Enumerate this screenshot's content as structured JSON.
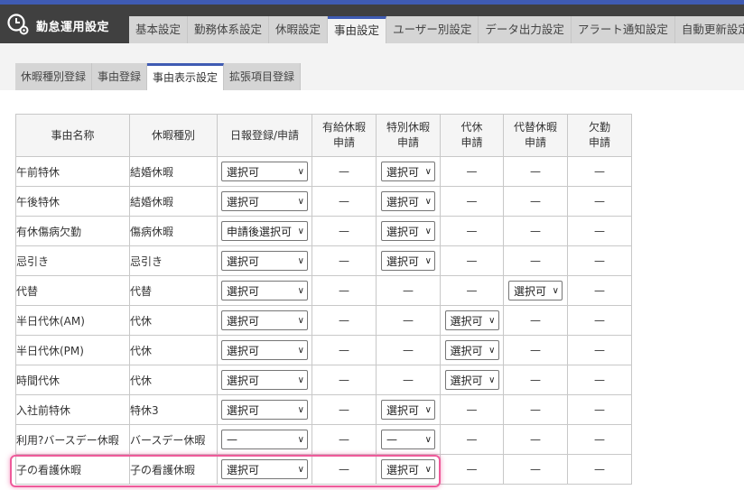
{
  "app": {
    "title": "勤怠運用設定"
  },
  "main_tabs": [
    {
      "label": "基本設定"
    },
    {
      "label": "勤務体系設定"
    },
    {
      "label": "休暇設定"
    },
    {
      "label": "事由設定"
    },
    {
      "label": "ユーザー別設定"
    },
    {
      "label": "データ出力設定"
    },
    {
      "label": "アラート通知設定"
    },
    {
      "label": "自動更新設定"
    }
  ],
  "sub_tabs": [
    {
      "label": "休暇種別登録"
    },
    {
      "label": "事由登録"
    },
    {
      "label": "事由表示設定"
    },
    {
      "label": "拡張項目登録"
    }
  ],
  "table": {
    "headers": {
      "name": "事由名称",
      "kind": "休暇種別",
      "daily": "日報登録/申請",
      "paid": [
        "有給休暇",
        "申請"
      ],
      "special": [
        "特別休暇",
        "申請"
      ],
      "comp": [
        "代休",
        "申請"
      ],
      "subst": [
        "代替休暇",
        "申請"
      ],
      "absence": [
        "欠勤",
        "申請"
      ]
    },
    "dash": "—",
    "rows": [
      {
        "name": "午前特休",
        "kind": "結婚休暇",
        "daily": "選択可",
        "paid": null,
        "special": "選択可",
        "comp": null,
        "subst": null,
        "absence": null
      },
      {
        "name": "午後特休",
        "kind": "結婚休暇",
        "daily": "選択可",
        "paid": null,
        "special": "選択可",
        "comp": null,
        "subst": null,
        "absence": null
      },
      {
        "name": "有休傷病欠勤",
        "kind": "傷病休暇",
        "daily": "申請後選択可",
        "paid": null,
        "special": "選択可",
        "comp": null,
        "subst": null,
        "absence": null
      },
      {
        "name": "忌引き",
        "kind": "忌引き",
        "daily": "選択可",
        "paid": null,
        "special": "選択可",
        "comp": null,
        "subst": null,
        "absence": null
      },
      {
        "name": "代替",
        "kind": "代替",
        "daily": "選択可",
        "paid": null,
        "special": null,
        "comp": null,
        "subst": "選択可",
        "absence": null
      },
      {
        "name": "半日代休(AM)",
        "kind": "代休",
        "daily": "選択可",
        "paid": null,
        "special": null,
        "comp": "選択可",
        "subst": null,
        "absence": null
      },
      {
        "name": "半日代休(PM)",
        "kind": "代休",
        "daily": "選択可",
        "paid": null,
        "special": null,
        "comp": "選択可",
        "subst": null,
        "absence": null
      },
      {
        "name": "時間代休",
        "kind": "代休",
        "daily": "選択可",
        "paid": null,
        "special": null,
        "comp": "選択可",
        "subst": null,
        "absence": null
      },
      {
        "name": "入社前特休",
        "kind": "特休3",
        "daily": "選択可",
        "paid": null,
        "special": "選択可",
        "comp": null,
        "subst": null,
        "absence": null
      },
      {
        "name": "利用?バースデー休暇",
        "kind": "バースデー休暇",
        "daily": "—",
        "paid": null,
        "special": "—",
        "comp": null,
        "subst": null,
        "absence": null
      },
      {
        "name": "子の看護休暇",
        "kind": "子の看護休暇",
        "daily": "選択可",
        "paid": null,
        "special": "選択可",
        "comp": null,
        "subst": null,
        "absence": null
      }
    ]
  },
  "colors": {
    "accent": "#3f5bb3",
    "header_bg": "#404040",
    "highlight": "#ee5a9a"
  }
}
